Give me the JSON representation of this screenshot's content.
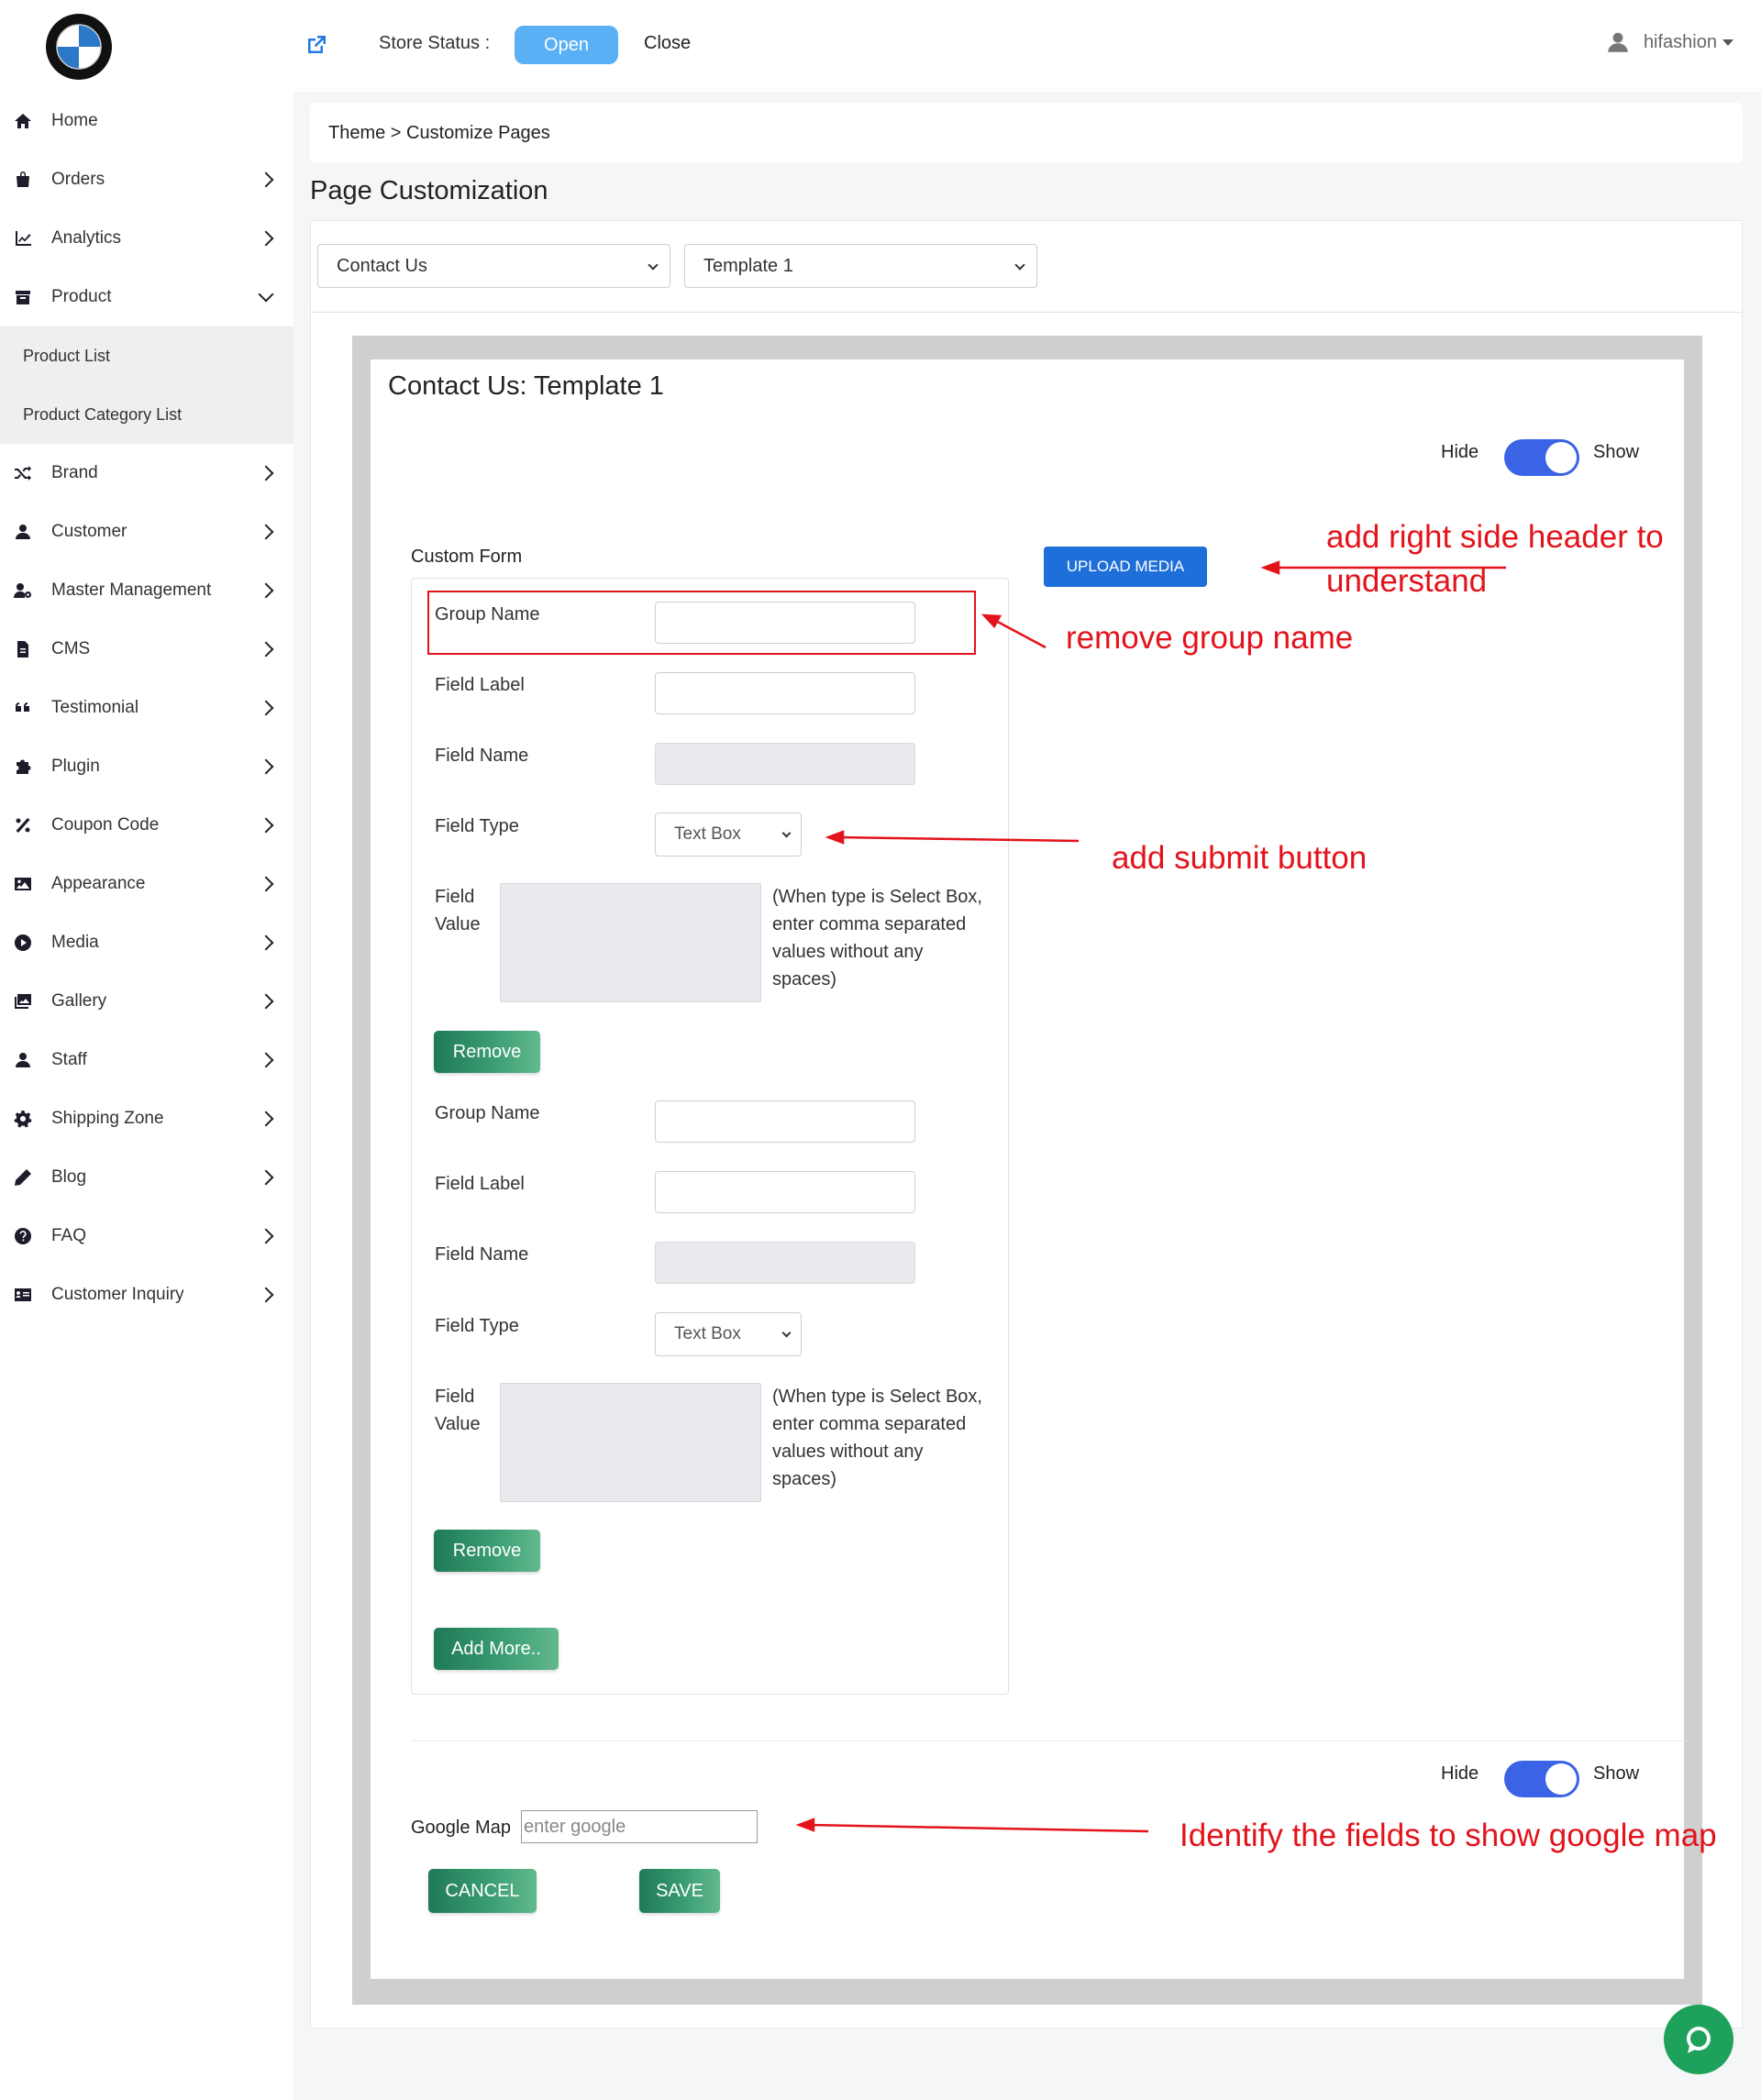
{
  "topbar": {
    "store_status_label": "Store Status :",
    "open_label": "Open",
    "close_label": "Close",
    "username": "hifashion"
  },
  "sidebar": {
    "items": [
      {
        "label": "Home",
        "icon": "home-icon"
      },
      {
        "label": "Orders",
        "icon": "shopping-bag-icon"
      },
      {
        "label": "Analytics",
        "icon": "line-chart-icon"
      },
      {
        "label": "Product",
        "icon": "archive-box-icon"
      },
      {
        "label": "Brand",
        "icon": "shuffle-icon"
      },
      {
        "label": "Customer",
        "icon": "user-icon"
      },
      {
        "label": "Master Management",
        "icon": "user-cog-icon"
      },
      {
        "label": "CMS",
        "icon": "file-icon"
      },
      {
        "label": "Testimonial",
        "icon": "quote-icon"
      },
      {
        "label": "Plugin",
        "icon": "puzzle-icon"
      },
      {
        "label": "Coupon Code",
        "icon": "percent-icon"
      },
      {
        "label": "Appearance",
        "icon": "image-icon"
      },
      {
        "label": "Media",
        "icon": "play-circle-icon"
      },
      {
        "label": "Gallery",
        "icon": "images-icon"
      },
      {
        "label": "Staff",
        "icon": "user-icon"
      },
      {
        "label": "Shipping Zone",
        "icon": "gear-icon"
      },
      {
        "label": "Blog",
        "icon": "pencil-icon"
      },
      {
        "label": "FAQ",
        "icon": "question-circle-icon"
      },
      {
        "label": "Customer Inquiry",
        "icon": "id-card-icon"
      }
    ],
    "product_sub": [
      "Product List",
      "Product Category List"
    ]
  },
  "breadcrumb": "Theme > Customize Pages",
  "page_title": "Page Customization",
  "page_select": "Contact Us",
  "template_select": "Template 1",
  "card_title": "Contact Us: Template 1",
  "toggle": {
    "hide": "Hide",
    "show": "Show",
    "state": "show"
  },
  "custom_form_label": "Custom Form",
  "upload_media_label": "UPLOAD MEDIA",
  "groups": [
    {
      "group_name_label": "Group Name",
      "field_label_label": "Field Label",
      "field_name_label": "Field Name",
      "field_type_label": "Field Type",
      "field_type_value": "Text Box",
      "field_value_label_1": "Field",
      "field_value_label_2": "Value",
      "hint": "(When type is Select Box, enter comma separated values without any spaces)",
      "remove_label": "Remove"
    },
    {
      "group_name_label": "Group Name",
      "field_label_label": "Field Label",
      "field_name_label": "Field Name",
      "field_type_label": "Field Type",
      "field_type_value": "Text Box",
      "field_value_label_1": "Field",
      "field_value_label_2": "Value",
      "hint": "(When type is Select Box, enter comma separated values without any spaces)",
      "remove_label": "Remove"
    }
  ],
  "add_more_label": "Add More..",
  "google_map_label": "Google Map",
  "google_map_placeholder": "enter google",
  "cancel_label": "CANCEL",
  "save_label": "SAVE",
  "annotations": {
    "right_header": "add right side header to understand",
    "remove_group": "remove group name",
    "submit_button": "add submit button",
    "google_map": "Identify the fields to show google map"
  },
  "colors": {
    "annotation": "#e3131b",
    "open_button": "#5ab0f4",
    "upload_button": "#1e6fd9",
    "toggle": "#3a63e6",
    "green_button": "#2f8a63",
    "chat": "#1ea15a"
  }
}
